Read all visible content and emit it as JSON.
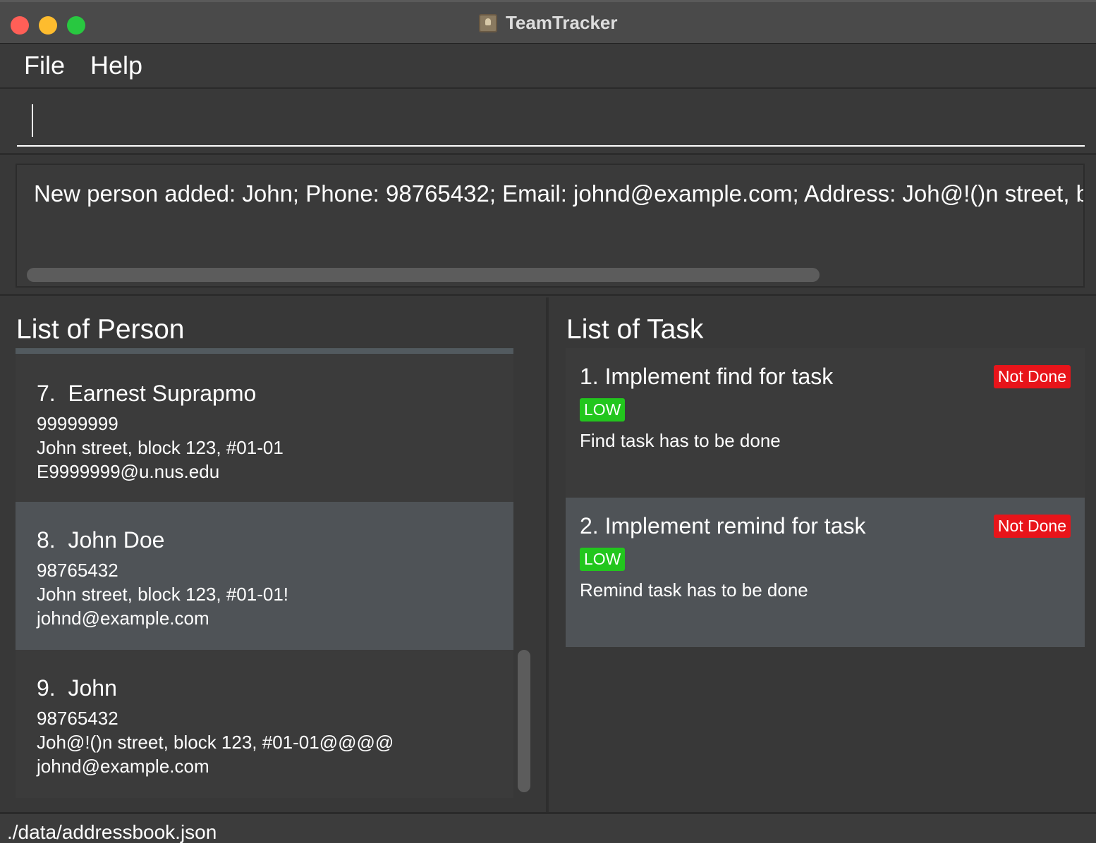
{
  "window": {
    "title": "TeamTracker"
  },
  "menu": {
    "items": [
      {
        "label": "File"
      },
      {
        "label": "Help"
      }
    ]
  },
  "command": {
    "value": "",
    "placeholder": ""
  },
  "result": {
    "text": "New person added: John; Phone: 98765432; Email: johnd@example.com; Address: Joh@!()n street, blc"
  },
  "persons": {
    "heading": "List of Person",
    "items": [
      {
        "index": "7.",
        "name": "Earnest Suprapmo",
        "phone": "99999999",
        "address": "John street, block 123, #01-01",
        "email": "E9999999@u.nus.edu"
      },
      {
        "index": "8.",
        "name": "John Doe",
        "phone": "98765432",
        "address": "John street, block 123, #01-01!",
        "email": "johnd@example.com"
      },
      {
        "index": "9.",
        "name": "John",
        "phone": "98765432",
        "address": "Joh@!()n street, block 123, #01-01@@@@",
        "email": "johnd@example.com"
      }
    ]
  },
  "tasks": {
    "heading": "List of Task",
    "items": [
      {
        "title": "1. Implement find for task",
        "status": "Not Done",
        "priority": "LOW",
        "description": "Find task has to be done"
      },
      {
        "title": "2. Implement remind for task",
        "status": "Not Done",
        "priority": "LOW",
        "description": "Remind task has to be done"
      }
    ]
  },
  "status_bar": {
    "path": "./data/addressbook.json"
  },
  "colors": {
    "not_done": "#e8141a",
    "low_priority": "#22c61d",
    "selected_row": "#4f5357",
    "background": "#383838"
  }
}
